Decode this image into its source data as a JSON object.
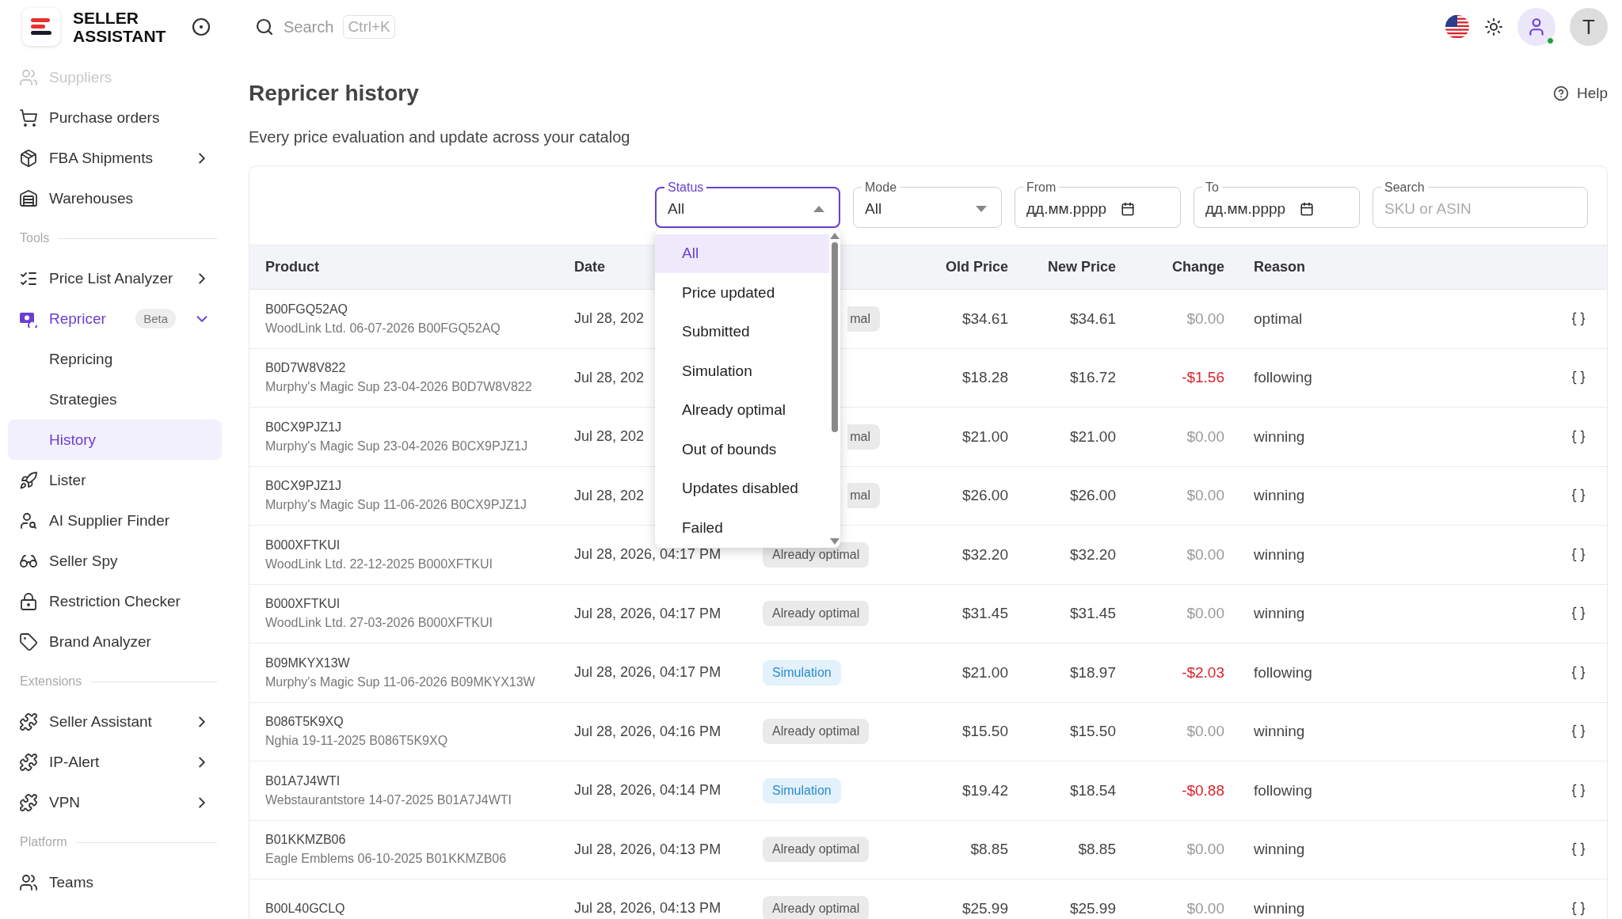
{
  "sidebar": {
    "brand": "SELLER ASSISTANT",
    "groups": [
      {
        "items": [
          {
            "label": "Suppliers",
            "faded": true,
            "selected": false
          },
          {
            "label": "Purchase orders",
            "selected": false
          },
          {
            "label": "FBA Shipments",
            "selected": false,
            "expanded": false
          },
          {
            "label": "Warehouses",
            "selected": false
          }
        ]
      },
      {
        "title": "Tools",
        "items": [
          {
            "label": "Price List Analyzer",
            "selected": false,
            "expanded": false
          },
          {
            "label": "Repricer",
            "badge": "Beta",
            "selected": false,
            "expanded": true,
            "children": [
              {
                "label": "Repricing",
                "selected": false
              },
              {
                "label": "Strategies",
                "selected": false
              },
              {
                "label": "History",
                "selected": true
              }
            ]
          },
          {
            "label": "Lister",
            "selected": false
          },
          {
            "label": "AI Supplier Finder",
            "selected": false
          },
          {
            "label": "Seller Spy",
            "selected": false
          },
          {
            "label": "Restriction Checker",
            "selected": false
          },
          {
            "label": "Brand Analyzer",
            "selected": false
          }
        ]
      },
      {
        "title": "Extensions",
        "items": [
          {
            "label": "Seller Assistant",
            "selected": false,
            "expanded": false
          },
          {
            "label": "IP-Alert",
            "selected": false,
            "expanded": false
          },
          {
            "label": "VPN",
            "selected": false,
            "expanded": false
          }
        ]
      },
      {
        "title": "Platform",
        "items": [
          {
            "label": "Teams",
            "selected": false
          }
        ]
      }
    ]
  },
  "topbar": {
    "search": {
      "placeholder": "Search",
      "shortcut": "Ctrl+K"
    },
    "avatar": "T",
    "online": true
  },
  "page": {
    "title": "Repricer history",
    "subtitle": "Every price evaluation and update across your catalog",
    "help": "Help"
  },
  "filters": [
    {
      "kind": "select",
      "label": "Status",
      "value": "All",
      "focused": true
    },
    {
      "kind": "select",
      "label": "Mode",
      "value": "All",
      "focused": false
    },
    {
      "kind": "date",
      "label": "From",
      "value": "дд.мм.рррр",
      "focused": false
    },
    {
      "kind": "date",
      "label": "To",
      "value": "дд.мм.рррр",
      "focused": false
    },
    {
      "kind": "text",
      "label": "Search",
      "placeholder": "SKU or ASIN",
      "focused": false
    }
  ],
  "status_menu": {
    "options": [
      {
        "label": "All",
        "selected": true
      },
      {
        "label": "Price updated",
        "selected": false
      },
      {
        "label": "Submitted",
        "selected": false
      },
      {
        "label": "Simulation",
        "selected": false
      },
      {
        "label": "Already optimal",
        "selected": false
      },
      {
        "label": "Out of bounds",
        "selected": false
      },
      {
        "label": "Updates disabled",
        "selected": false
      },
      {
        "label": "Failed",
        "selected": false
      }
    ]
  },
  "table": {
    "columns": [
      "Product",
      "Date",
      "Old Price",
      "New Price",
      "Change",
      "Reason"
    ],
    "rows": [
      {
        "sku": "B00FGQ52AQ",
        "detail": "WoodLink Ltd. 06-07-2026 B00FGQ52AQ",
        "date": "Jul 28, 202",
        "status": {
          "label": "mal",
          "kind": "optimal",
          "clipped": true
        },
        "old_price": "$34.61",
        "new_price": "$34.61",
        "change": "$0.00",
        "negative": false,
        "reason": "optimal"
      },
      {
        "sku": "B0D7W8V822",
        "detail": "Murphy's Magic Sup 23-04-2026 B0D7W8V822",
        "date": "Jul 28, 202",
        "old_price": "$18.28",
        "new_price": "$16.72",
        "change": "-$1.56",
        "negative": true,
        "reason": "following"
      },
      {
        "sku": "B0CX9PJZ1J",
        "detail": "Murphy's Magic Sup 23-04-2026 B0CX9PJZ1J",
        "date": "Jul 28, 202",
        "status": {
          "label": "mal",
          "kind": "optimal",
          "clipped": true
        },
        "old_price": "$21.00",
        "new_price": "$21.00",
        "change": "$0.00",
        "negative": false,
        "reason": "winning"
      },
      {
        "sku": "B0CX9PJZ1J",
        "detail": "Murphy's Magic Sup 11-06-2026 B0CX9PJZ1J",
        "date": "Jul 28, 202",
        "status": {
          "label": "mal",
          "kind": "optimal",
          "clipped": true
        },
        "old_price": "$26.00",
        "new_price": "$26.00",
        "change": "$0.00",
        "negative": false,
        "reason": "winning"
      },
      {
        "sku": "B000XFTKUI",
        "detail": "WoodLink Ltd. 22-12-2025 B000XFTKUI",
        "date": "Jul 28, 2026, 04:17 PM",
        "status": {
          "label": "Already optimal",
          "kind": "optimal",
          "clipped": false
        },
        "old_price": "$32.20",
        "new_price": "$32.20",
        "change": "$0.00",
        "negative": false,
        "reason": "winning"
      },
      {
        "sku": "B000XFTKUI",
        "detail": "WoodLink Ltd. 27-03-2026 B000XFTKUI",
        "date": "Jul 28, 2026, 04:17 PM",
        "status": {
          "label": "Already optimal",
          "kind": "optimal",
          "clipped": false
        },
        "old_price": "$31.45",
        "new_price": "$31.45",
        "change": "$0.00",
        "negative": false,
        "reason": "winning"
      },
      {
        "sku": "B09MKYX13W",
        "detail": "Murphy's Magic Sup 11-06-2026 B09MKYX13W",
        "date": "Jul 28, 2026, 04:17 PM",
        "status": {
          "label": "Simulation",
          "kind": "simulation",
          "clipped": false
        },
        "old_price": "$21.00",
        "new_price": "$18.97",
        "change": "-$2.03",
        "negative": true,
        "reason": "following"
      },
      {
        "sku": "B086T5K9XQ",
        "detail": "Nghia 19-11-2025 B086T5K9XQ",
        "date": "Jul 28, 2026, 04:16 PM",
        "status": {
          "label": "Already optimal",
          "kind": "optimal",
          "clipped": false
        },
        "old_price": "$15.50",
        "new_price": "$15.50",
        "change": "$0.00",
        "negative": false,
        "reason": "winning"
      },
      {
        "sku": "B01A7J4WTI",
        "detail": "Webstaurantstore 14-07-2025 B01A7J4WTI",
        "date": "Jul 28, 2026, 04:14 PM",
        "status": {
          "label": "Simulation",
          "kind": "simulation",
          "clipped": false
        },
        "old_price": "$19.42",
        "new_price": "$18.54",
        "change": "-$0.88",
        "negative": true,
        "reason": "following"
      },
      {
        "sku": "B01KKMZB06",
        "detail": "Eagle Emblems 06-10-2025 B01KKMZB06",
        "date": "Jul 28, 2026, 04:13 PM",
        "status": {
          "label": "Already optimal",
          "kind": "optimal",
          "clipped": false
        },
        "old_price": "$8.85",
        "new_price": "$8.85",
        "change": "$0.00",
        "negative": false,
        "reason": "winning"
      },
      {
        "sku": "B00L40GCLQ",
        "date": "Jul 28, 2026, 04:13 PM",
        "status": {
          "label": "Already optimal",
          "kind": "optimal",
          "clipped": false
        },
        "old_price": "$25.99",
        "new_price": "$25.99",
        "change": "$0.00",
        "negative": false,
        "reason": "winning"
      }
    ]
  }
}
